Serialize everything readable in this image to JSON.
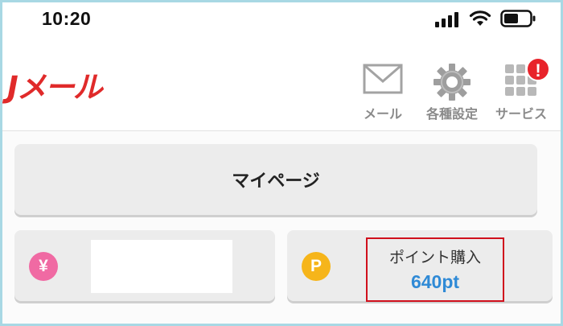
{
  "status_bar": {
    "time": "10:20",
    "icons": [
      "cellular-signal-icon",
      "wifi-icon",
      "battery-icon"
    ]
  },
  "header": {
    "logo_text": "Jメール",
    "nav": [
      {
        "label": "メール",
        "icon": "envelope-icon"
      },
      {
        "label": "各種設定",
        "icon": "gear-icon"
      },
      {
        "label": "サービス",
        "icon": "grid-icon",
        "badge": "!"
      }
    ]
  },
  "main": {
    "mypage_label": "マイページ",
    "yen_card": {
      "icon_glyph": "¥",
      "icon": "yen-icon",
      "value": ""
    },
    "point_card": {
      "icon_glyph": "P",
      "icon": "point-icon",
      "label": "ポイント購入",
      "value": "640pt"
    }
  },
  "colors": {
    "brand_red": "#e02a2a",
    "badge_red": "#e8232a",
    "yen_pink": "#f06aa3",
    "point_orange": "#f6b51a",
    "point_value_blue": "#2f8ad6",
    "highlight_border": "#d0101c",
    "frame_border": "#a8d8e4"
  }
}
